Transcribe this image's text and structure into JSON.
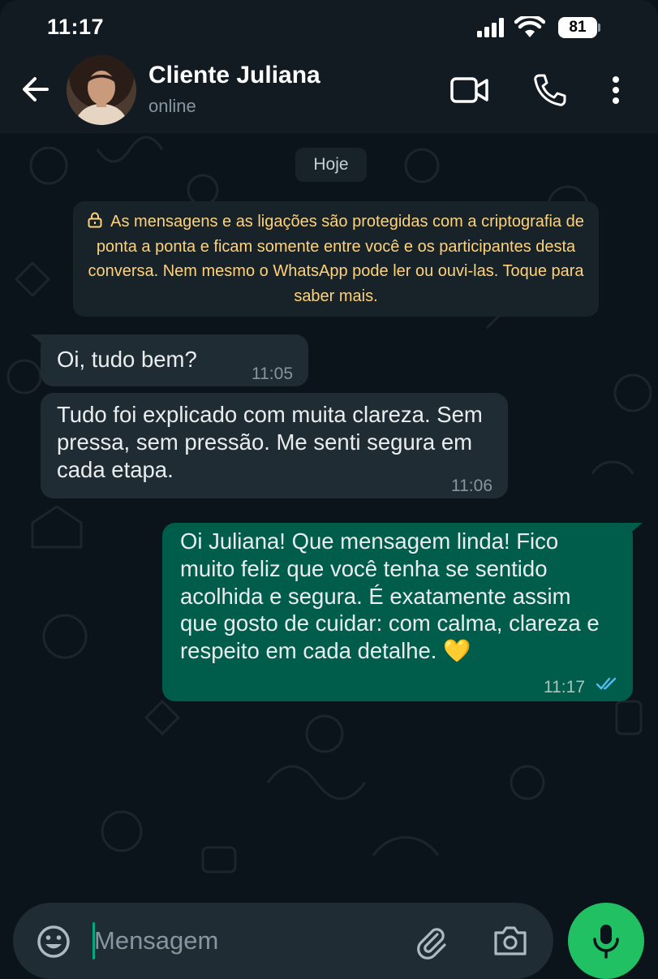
{
  "status_bar": {
    "time": "11:17",
    "battery": "81",
    "icons": [
      "signal-icon",
      "wifi-icon",
      "battery-icon"
    ]
  },
  "header": {
    "contact_name": "Cliente Juliana",
    "contact_status": "online",
    "icons": [
      "back-arrow-icon",
      "video-call-icon",
      "phone-icon",
      "more-vert-icon"
    ]
  },
  "chat": {
    "date_chip": "Hoje",
    "encryption_notice": "As mensagens e as ligações são protegidas com a criptografia de ponta a ponta e ficam somente entre você e os participantes desta conversa. Nem mesmo o WhatsApp pode ler ou ouvi-las. Toque para saber mais.",
    "messages": [
      {
        "direction": "incoming",
        "text": "Oi, tudo bem?",
        "time": "11:05"
      },
      {
        "direction": "incoming",
        "text": "Tudo foi explicado com muita clareza. Sem pressa, sem pressão. Me senti segura em cada etapa.",
        "time": "11:06"
      },
      {
        "direction": "outgoing",
        "text": "Oi Juliana! Que mensagem linda! Fico muito feliz que você tenha se sentido acolhida e segura. É exatamente assim que gosto de cuidar: com calma, clareza e respeito em cada detalhe. 💛",
        "time": "11:17",
        "read": true
      }
    ]
  },
  "composer": {
    "placeholder": "Mensagem",
    "value": "",
    "icons": [
      "emoji-icon",
      "attach-icon",
      "camera-icon",
      "mic-icon"
    ]
  },
  "colors": {
    "background": "#0b141a",
    "bar": "#121b22",
    "incoming_bubble": "#202c33",
    "outgoing_bubble": "#005c4b",
    "accent": "#21c063",
    "notice_text": "#ffd279",
    "read_ticks": "#53bdeb"
  }
}
